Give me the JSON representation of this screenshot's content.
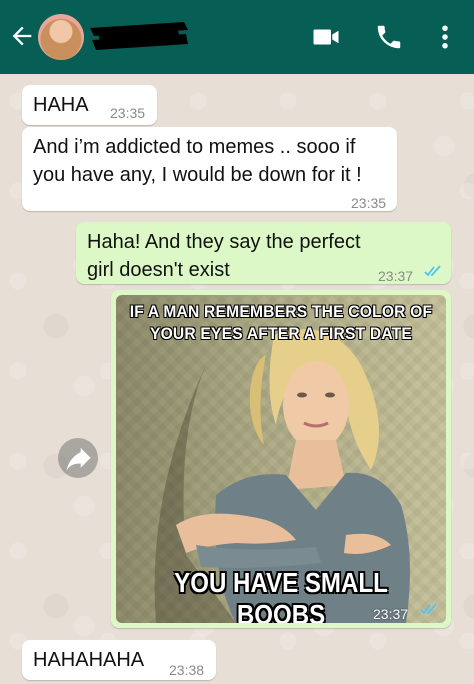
{
  "header": {
    "bg_color": "#075e54",
    "icons": [
      "back-arrow-icon",
      "avatar",
      "video-call-icon",
      "voice-call-icon",
      "more-options-icon"
    ]
  },
  "messages": [
    {
      "direction": "incoming",
      "text": "HAHA",
      "time": "23:35"
    },
    {
      "direction": "incoming",
      "text": "And i’m addicted to memes .. sooo if you have any, I would be down for it !",
      "time": "23:35"
    },
    {
      "direction": "outgoing",
      "text": "Haha! And they say the perfect girl doesn't exist",
      "time": "23:37",
      "status": "read"
    },
    {
      "direction": "outgoing",
      "type": "image",
      "meme_top": "IF A MAN REMEMBERS THE COLOR OF YOUR EYES AFTER A FIRST DATE",
      "meme_bottom": "YOU HAVE SMALL BOOBS",
      "time": "23:37",
      "status": "read"
    },
    {
      "direction": "incoming",
      "text": "HAHAHAHA",
      "time": "23:38"
    }
  ],
  "colors": {
    "outgoing_bubble": "#dcf8c6",
    "incoming_bubble": "#ffffff",
    "read_ticks": "#4fc3f7"
  }
}
